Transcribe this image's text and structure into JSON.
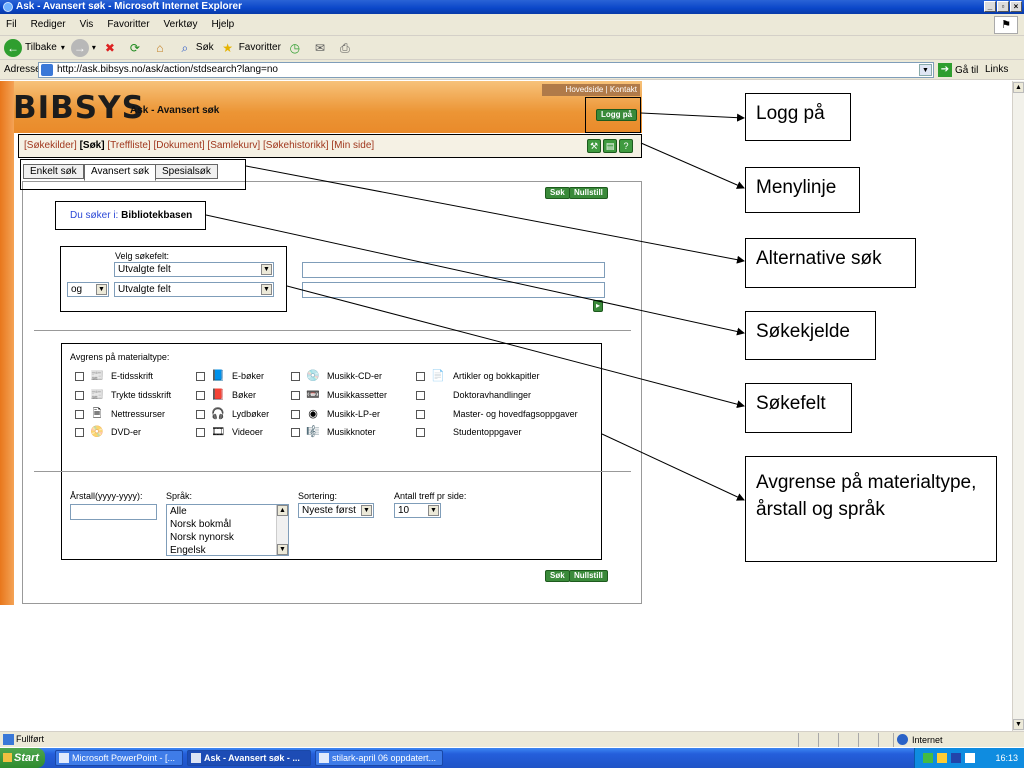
{
  "window": {
    "title": "Ask - Avansert søk - Microsoft Internet Explorer",
    "controls": [
      "_",
      "▫",
      "×"
    ]
  },
  "menubar": [
    "Fil",
    "Rediger",
    "Vis",
    "Favoritter",
    "Verktøy",
    "Hjelp"
  ],
  "toolbar": {
    "back": "Tilbake",
    "search": "Søk",
    "favorites": "Favoritter"
  },
  "address": {
    "label": "Adresse",
    "url": "http://ask.bibsys.no/ask/action/stdsearch?lang=no",
    "go": "Gå til",
    "links": "Links"
  },
  "page": {
    "logo": "BIBSYS",
    "app_title": "Ask  - Avansert søk",
    "top_links": "Hovedside | Kontakt",
    "login_button": "Logg på",
    "nav": {
      "items": [
        "[Søkekilder]",
        "[Søk]",
        "[Treffliste]",
        "[Dokument]",
        "[Samlekurv]",
        "[Søkehistorikk]",
        "[Min side]"
      ]
    },
    "tabs": [
      "Enkelt søk",
      "Avansert søk",
      "Spesialsøk"
    ],
    "search_button": "Søk",
    "reset_button": "Nullstill",
    "source": {
      "prefix": "Du søker i:",
      "value": "Bibliotekbasen"
    },
    "field_label": "Velg søkefelt:",
    "field_select_1": "Utvalgte felt",
    "operator": "og",
    "field_select_2": "Utvalgte felt",
    "material": {
      "title": "Avgrens på materialtype:",
      "items": [
        {
          "label": "E-tidsskrift",
          "icon": "ejournal-icon"
        },
        {
          "label": "E-bøker",
          "icon": "ebook-icon"
        },
        {
          "label": "Musikk-CD-er",
          "icon": "music-cd-icon"
        },
        {
          "label": "Artikler og bokkapitler",
          "icon": "article-icon"
        },
        {
          "label": "Trykte tidsskrift",
          "icon": "journal-icon"
        },
        {
          "label": "Bøker",
          "icon": "book-icon"
        },
        {
          "label": "Musikkassetter",
          "icon": "cassette-icon"
        },
        {
          "label": "Doktoravhandlinger",
          "icon": ""
        },
        {
          "label": "Nettressurser",
          "icon": "web-resource-icon"
        },
        {
          "label": "Lydbøker",
          "icon": "audiobook-icon"
        },
        {
          "label": "Musikk-LP-er",
          "icon": "vinyl-icon"
        },
        {
          "label": "Master- og hovedfagsoppgaver",
          "icon": ""
        },
        {
          "label": "DVD-er",
          "icon": "dvd-icon"
        },
        {
          "label": "Videoer",
          "icon": "video-icon"
        },
        {
          "label": "Musikknoter",
          "icon": "sheet-music-icon"
        },
        {
          "label": "Studentoppgaver",
          "icon": ""
        }
      ]
    },
    "year_label": "Årstall(yyyy-yyyy):",
    "language_label": "Språk:",
    "languages": [
      "Alle",
      "Norsk bokmål",
      "Norsk nynorsk",
      "Engelsk"
    ],
    "sort_label": "Sortering:",
    "sort_value": "Nyeste først",
    "hits_label": "Antall treff pr side:",
    "hits_value": "10"
  },
  "callouts": {
    "login": "Logg på",
    "menu": "Menylinje",
    "alt_search": "Alternative søk",
    "source": "Søkekjelde",
    "field": "Søkefelt",
    "limit": "Avgrense på materialtype, årstall og språk"
  },
  "status": {
    "text": "Fullført",
    "zone": "Internet"
  },
  "taskbar": {
    "start": "Start",
    "tasks": [
      "Microsoft PowerPoint - [...",
      "Ask - Avansert søk - ...",
      "stilark-april 06 oppdatert..."
    ],
    "clock": "16:13"
  }
}
